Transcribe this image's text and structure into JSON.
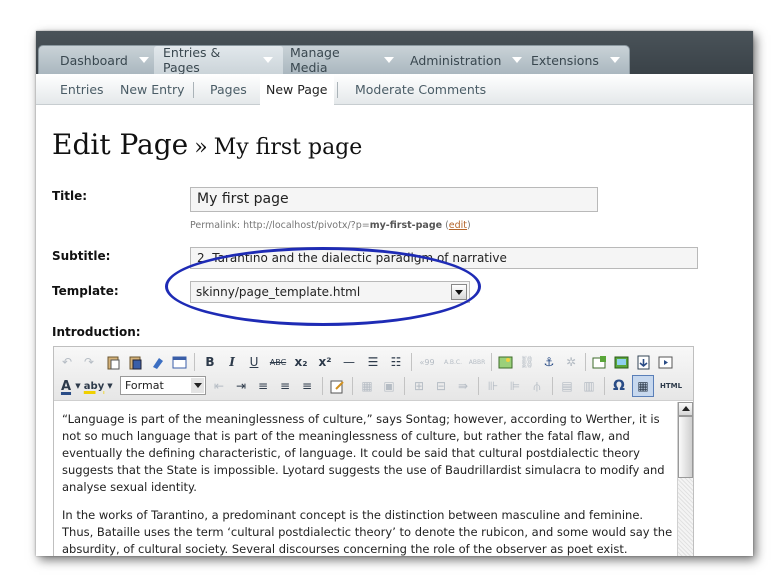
{
  "nav": {
    "items": [
      {
        "label": "Dashboard"
      },
      {
        "label": "Entries & Pages"
      },
      {
        "label": "Manage Media"
      },
      {
        "label": "Administration"
      },
      {
        "label": "Extensions"
      }
    ]
  },
  "subnav": {
    "items": [
      {
        "label": "Entries"
      },
      {
        "label": "New Entry"
      },
      {
        "label": "Pages"
      },
      {
        "label": "New Page"
      },
      {
        "label": "Moderate Comments"
      }
    ]
  },
  "heading": {
    "main": "Edit Page",
    "sep": "»",
    "sub": "My first page"
  },
  "form": {
    "title_label": "Title:",
    "title_value": "My first page",
    "permalink_prefix": "Permalink: http://localhost/pivotx/?p=",
    "permalink_slug": "my-first-page",
    "permalink_edit": "edit",
    "subtitle_label": "Subtitle:",
    "subtitle_value": "2. Tarantino and the dialectic paradigm of narrative",
    "template_label": "Template:",
    "template_value": "skinny/page_template.html",
    "intro_label": "Introduction:"
  },
  "editor": {
    "format_value": "Format",
    "paragraph1": "“Language is part of the meaninglessness of culture,” says Sontag; however, according to Werther, it is not so much language that is part of the meaninglessness of culture, but rather the fatal flaw, and eventually the defining characteristic, of language. It could be said that cultural postdialectic theory suggests that the State is impossible. Lyotard suggests the use of Baudrillardist simulacra to modify and analyse sexual identity.",
    "paragraph2": "In the works of Tarantino, a predominant concept is the distinction between masculine and feminine. Thus, Bataille uses the term ‘cultural postdialectic theory’ to denote the rubicon, and some would say the absurdity, of cultural society. Several discourses concerning the role of the observer as poet exist.",
    "toolbar": {
      "bold": "B",
      "italic": "I",
      "underline": "U",
      "strike": "ABC",
      "subscript": "x₂",
      "superscript": "x²",
      "hr": "—",
      "cite": "«99",
      "acronym": "A.B.C.",
      "abbr": "ABBR",
      "charmap": "Ω",
      "html": "HTML",
      "text_color": "A",
      "highlight": "aby"
    }
  },
  "colors": {
    "annotation": "#1e2bb5",
    "topbar": "#434c52",
    "accent_link": "#b4652a"
  }
}
